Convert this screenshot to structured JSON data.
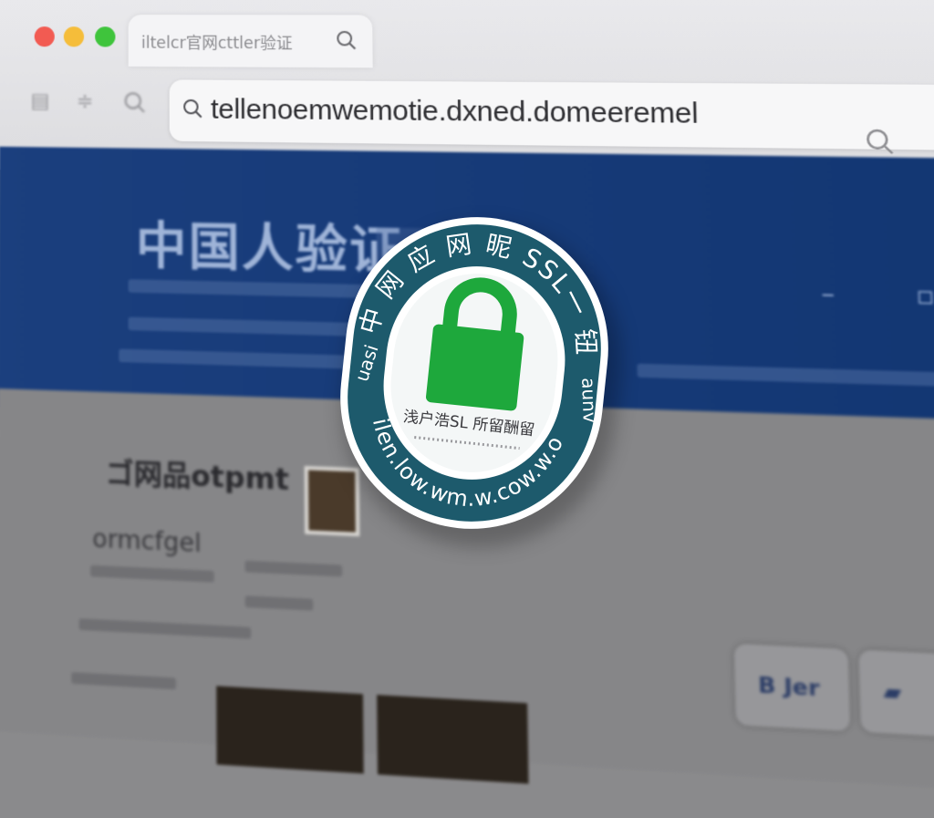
{
  "browser": {
    "tab_title": "iltelcr官网cttler验证",
    "address": "tellenoemwemotie.dxned.domeeremel"
  },
  "hero": {
    "title": "中国人验证"
  },
  "content": {
    "title": "ゴ网品otpmt",
    "subtitle": "ormcfgel",
    "button_label": "B Jer"
  },
  "badge": {
    "top_text": "中 网 应 网 昵 SSL一 钮",
    "left_text": "uasi",
    "right_text": "aunv",
    "bottom_text": "ilen.low.wm.w.cow.w.o",
    "center_text": "浅户浩SL 所留酬留",
    "colors": {
      "ring": "#1d5a6c",
      "lock": "#1ea83c",
      "inner": "#f4f7f7"
    }
  },
  "icons": [
    "search-icon",
    "lock-icon",
    "sidebar-icon",
    "share-icon"
  ]
}
